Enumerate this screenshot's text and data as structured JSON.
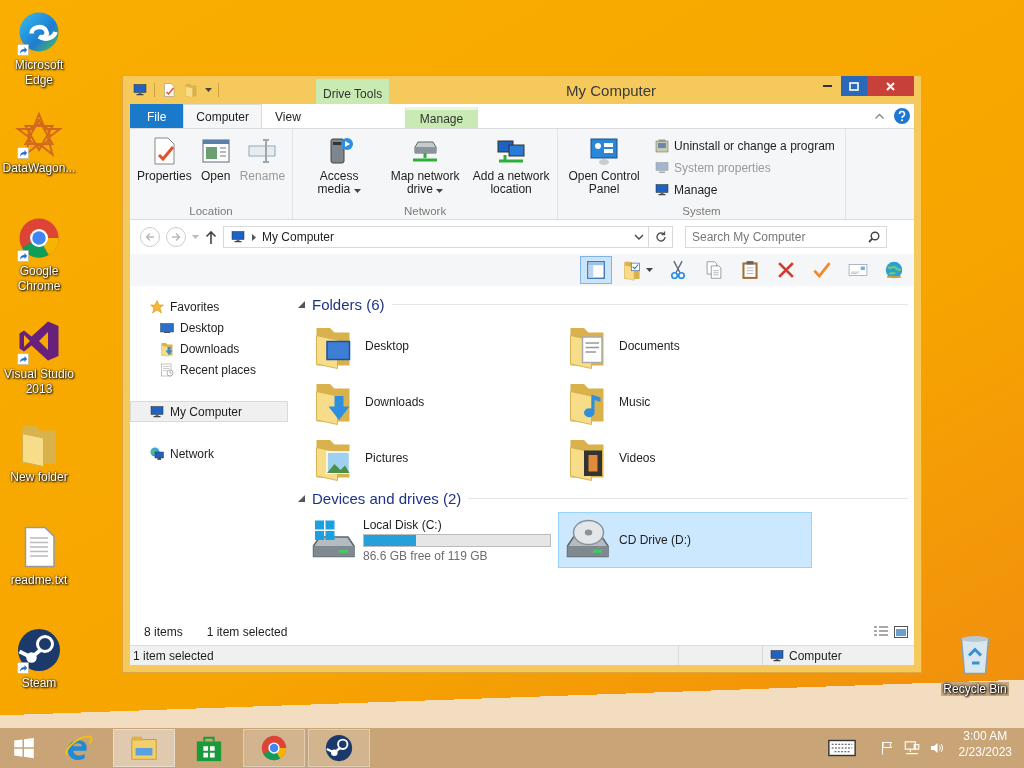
{
  "desktop_icons": [
    {
      "label": "Microsoft Edge",
      "kind": "edge",
      "shortcut": true
    },
    {
      "label": "DataWagon...",
      "kind": "star-logo",
      "shortcut": true
    },
    {
      "label": "Google Chrome",
      "kind": "chrome",
      "shortcut": true
    },
    {
      "label": "Visual Studio 2013",
      "kind": "visual-studio",
      "shortcut": true
    },
    {
      "label": "New folder",
      "kind": "folder",
      "shortcut": false
    },
    {
      "label": "readme.txt",
      "kind": "text-file",
      "shortcut": false
    },
    {
      "label": "Steam",
      "kind": "steam",
      "shortcut": true
    }
  ],
  "recycle_bin": {
    "label": "Recycle Bin"
  },
  "window": {
    "title": "My Computer",
    "context_group": "Drive Tools",
    "tabs": [
      {
        "label": "File",
        "kind": "file",
        "selected": false
      },
      {
        "label": "Computer",
        "kind": "tab",
        "selected": true
      },
      {
        "label": "View",
        "kind": "tab",
        "selected": false
      },
      {
        "label": "Manage",
        "kind": "context",
        "selected": false
      }
    ],
    "ribbon": [
      {
        "label": "Location",
        "commands": [
          {
            "label": "Properties",
            "kind": "properties",
            "disabled": false,
            "dropdown": false
          },
          {
            "label": "Open",
            "kind": "open",
            "disabled": false,
            "dropdown": false
          },
          {
            "label": "Rename",
            "kind": "rename",
            "disabled": true,
            "dropdown": false
          }
        ]
      },
      {
        "label": "Network",
        "commands": [
          {
            "label": "Access media",
            "kind": "access-media",
            "disabled": false,
            "dropdown": true
          },
          {
            "label": "Map network drive",
            "kind": "map-drive",
            "disabled": false,
            "dropdown": true
          },
          {
            "label": "Add a network location",
            "kind": "network-location",
            "disabled": false,
            "dropdown": false
          }
        ]
      },
      {
        "label": "System",
        "commands": [
          {
            "label": "Open Control Panel",
            "kind": "control-panel",
            "disabled": false,
            "dropdown": false
          }
        ],
        "small_commands": [
          {
            "label": "Uninstall or change a program",
            "kind": "uninstall",
            "disabled": false
          },
          {
            "label": "System properties",
            "kind": "system-properties",
            "disabled": true
          },
          {
            "label": "Manage",
            "kind": "manage",
            "disabled": false
          }
        ]
      }
    ],
    "address": {
      "path": "My Computer"
    },
    "search": {
      "placeholder": "Search My Computer"
    },
    "toolbar": [
      {
        "kind": "preview-pane",
        "selected": true,
        "dropdown": false
      },
      {
        "kind": "folder-options",
        "selected": false,
        "dropdown": true
      },
      {
        "kind": "cut",
        "selected": false,
        "dropdown": false
      },
      {
        "kind": "copy",
        "selected": false,
        "dropdown": false
      },
      {
        "kind": "paste",
        "selected": false,
        "dropdown": false
      },
      {
        "kind": "delete",
        "selected": false,
        "dropdown": false
      },
      {
        "kind": "check",
        "selected": false,
        "dropdown": false
      },
      {
        "kind": "card",
        "selected": false,
        "dropdown": false
      },
      {
        "kind": "globe",
        "selected": false,
        "dropdown": false
      }
    ],
    "navigation": [
      {
        "label": "Favorites",
        "kind": "star",
        "selected": false,
        "children": [
          {
            "label": "Desktop",
            "kind": "monitor",
            "selected": false
          },
          {
            "label": "Downloads",
            "kind": "downloads-small",
            "selected": false
          },
          {
            "label": "Recent places",
            "kind": "recent",
            "selected": false
          }
        ]
      },
      {
        "label": "My Computer",
        "kind": "computer",
        "selected": true
      },
      {
        "label": "Network",
        "kind": "network",
        "selected": false
      }
    ],
    "sections": [
      {
        "title": "Folders (6)",
        "expanded": true,
        "items": [
          {
            "label": "Desktop",
            "kind": "desktop",
            "selected": false
          },
          {
            "label": "Documents",
            "kind": "documents",
            "selected": false
          },
          {
            "label": "Downloads",
            "kind": "downloads",
            "selected": false
          },
          {
            "label": "Music",
            "kind": "music",
            "selected": false
          },
          {
            "label": "Pictures",
            "kind": "pictures",
            "selected": false
          },
          {
            "label": "Videos",
            "kind": "videos",
            "selected": false
          }
        ]
      },
      {
        "title": "Devices and drives (2)",
        "expanded": true,
        "items": [
          {
            "label": "Local Disk (C:)",
            "kind": "hard-drive",
            "level": 0.28,
            "detail": "86.6 GB free of 119 GB",
            "selected": false
          },
          {
            "label": "CD Drive (D:)",
            "kind": "cd-drive",
            "selected": true
          }
        ]
      }
    ],
    "item_count": "8 items",
    "selection_count": "1 item selected",
    "status_bar": {
      "text": "1 item selected",
      "location": "Computer"
    }
  },
  "taskbar": {
    "apps": [
      {
        "kind": "ie",
        "running": false,
        "selected": false
      },
      {
        "kind": "explorer",
        "running": true,
        "selected": true
      },
      {
        "kind": "store",
        "running": false,
        "selected": false
      },
      {
        "kind": "chrome",
        "running": true,
        "selected": false
      },
      {
        "kind": "steam",
        "running": true,
        "selected": false
      }
    ],
    "clock": {
      "time": "3:00 AM",
      "date": "2/23/2023"
    }
  }
}
